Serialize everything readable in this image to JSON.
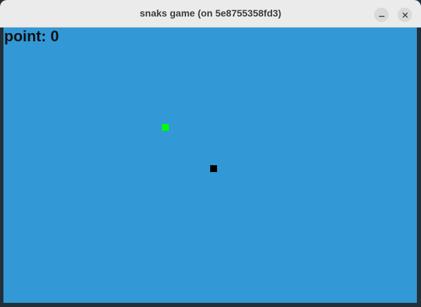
{
  "window": {
    "title": "snaks game (on 5e8755358fd3)",
    "controls": {
      "minimize_icon": "minimize-icon",
      "close_icon": "close-icon"
    }
  },
  "game": {
    "score_text": "point: 0",
    "background_color": "#3398d6",
    "food_color": "#00ff00",
    "snake_color": "#000000",
    "snake_length": 1
  }
}
